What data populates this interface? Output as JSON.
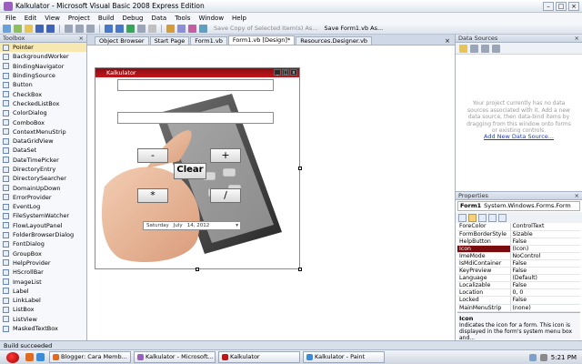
{
  "window": {
    "title": "Kalkulator - Microsoft Visual Basic 2008 Express Edition"
  },
  "menu": [
    "File",
    "Edit",
    "View",
    "Project",
    "Build",
    "Debug",
    "Data",
    "Tools",
    "Window",
    "Help"
  ],
  "toolbar": {
    "save_copy": "Save Copy of Selected Item(s) As...",
    "save_form": "Save Form1.vb As..."
  },
  "toolbox": {
    "title": "Toolbox",
    "items": [
      "Pointer",
      "BackgroundWorker",
      "BindingNavigator",
      "BindingSource",
      "Button",
      "CheckBox",
      "CheckedListBox",
      "ColorDialog",
      "ComboBox",
      "ContextMenuStrip",
      "DataGridView",
      "DataSet",
      "DateTimePicker",
      "DirectoryEntry",
      "DirectorySearcher",
      "DomainUpDown",
      "ErrorProvider",
      "EventLog",
      "FileSystemWatcher",
      "FlowLayoutPanel",
      "FolderBrowserDialog",
      "FontDialog",
      "GroupBox",
      "HelpProvider",
      "HScrollBar",
      "ImageList",
      "Label",
      "LinkLabel",
      "ListBox",
      "ListView",
      "MaskedTextBox"
    ]
  },
  "tabs": [
    "Object Browser",
    "Start Page",
    "Form1.vb",
    "Form1.vb [Design]*",
    "Resources.Designer.vb"
  ],
  "form": {
    "title": "Kalkulator",
    "buttons": {
      "minus": "-",
      "plus": "+",
      "clear": "Clear",
      "times": "*",
      "divide": "/"
    },
    "date": {
      "day": "Saturday",
      "month": "July",
      "dayNum": "14, 2012"
    }
  },
  "datasources": {
    "title": "Data Sources",
    "message": "Your project currently has no data sources associated with it. Add a new data source, then data-bind items by dragging from this window onto forms or existing controls.",
    "link": "Add New Data Source..."
  },
  "properties": {
    "title": "Properties",
    "object_name": "Form1",
    "object_type": "System.Windows.Forms.Form",
    "rows": [
      {
        "name": "ForeColor",
        "value": "ControlText"
      },
      {
        "name": "FormBorderStyle",
        "value": "Sizable"
      },
      {
        "name": "HelpButton",
        "value": "False"
      },
      {
        "name": "Icon",
        "value": "(Icon)"
      },
      {
        "name": "ImeMode",
        "value": "NoControl"
      },
      {
        "name": "IsMdiContainer",
        "value": "False"
      },
      {
        "name": "KeyPreview",
        "value": "False"
      },
      {
        "name": "Language",
        "value": "(Default)"
      },
      {
        "name": "Localizable",
        "value": "False"
      },
      {
        "name": "Location",
        "value": "0, 0"
      },
      {
        "name": "Locked",
        "value": "False"
      },
      {
        "name": "MainMenuStrip",
        "value": "(none)"
      }
    ],
    "selected_row": 3,
    "desc_title": "Icon",
    "desc_text": "Indicates the icon for a form. This icon is displayed in the form's system menu box and..."
  },
  "status": "Build succeeded",
  "taskbar": {
    "tasks": [
      {
        "label": "Blogger: Cara Memb...",
        "color": "#e26b1f"
      },
      {
        "label": "Kalkulator - Microsoft...",
        "color": "#9b5fc0"
      },
      {
        "label": "Kalkulator",
        "color": "#c3141a"
      },
      {
        "label": "Kalkulator - Paint",
        "color": "#3a8bd8"
      }
    ],
    "time": "5:21 PM"
  }
}
